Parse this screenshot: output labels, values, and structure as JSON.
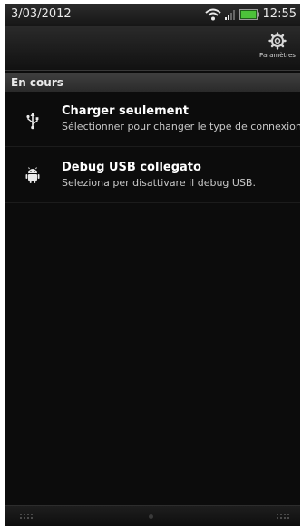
{
  "status_bar": {
    "date": "3/03/2012",
    "time": "12:55",
    "icons": [
      "wifi-icon",
      "signal-icon",
      "battery-icon"
    ]
  },
  "toolbar": {
    "settings_label": "Paramètres",
    "settings_icon": "gear-icon"
  },
  "section": {
    "title": "En cours"
  },
  "notifications": [
    {
      "icon": "usb-icon",
      "title": "Charger seulement",
      "subtitle": "Sélectionner pour changer le type de connexion."
    },
    {
      "icon": "android-debug-icon",
      "title": "Debug USB collegato",
      "subtitle": "Seleziona per disattivare il debug USB."
    }
  ],
  "colors": {
    "background": "#0c0c0c",
    "title_text": "#ffffff",
    "subtitle_text": "#c8c8c8",
    "battery_accent": "#4cc23a"
  }
}
